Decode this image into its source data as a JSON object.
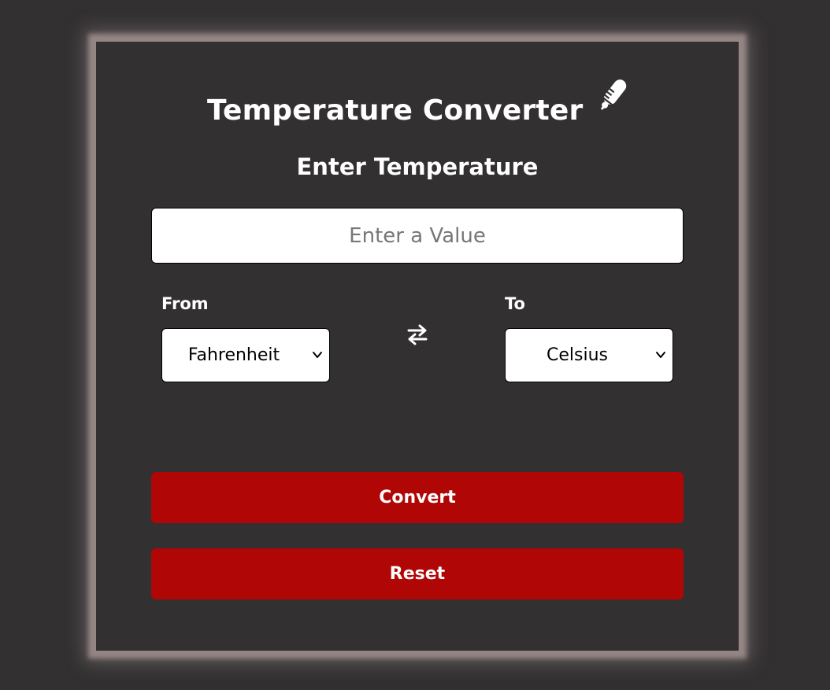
{
  "header": {
    "title": "Temperature Converter",
    "icon": "thermometer-icon"
  },
  "form": {
    "subtitle": "Enter Temperature",
    "input_placeholder": "Enter a Value",
    "input_value": "",
    "from_label": "From",
    "to_label": "To",
    "from_selected": "Fahrenheit",
    "to_selected": "Celsius",
    "swap_icon": "swap-arrows-icon"
  },
  "actions": {
    "convert_label": "Convert",
    "reset_label": "Reset"
  },
  "colors": {
    "background": "#323031",
    "card_glow": "#958684",
    "button": "#b00606",
    "text": "#ffffff"
  }
}
